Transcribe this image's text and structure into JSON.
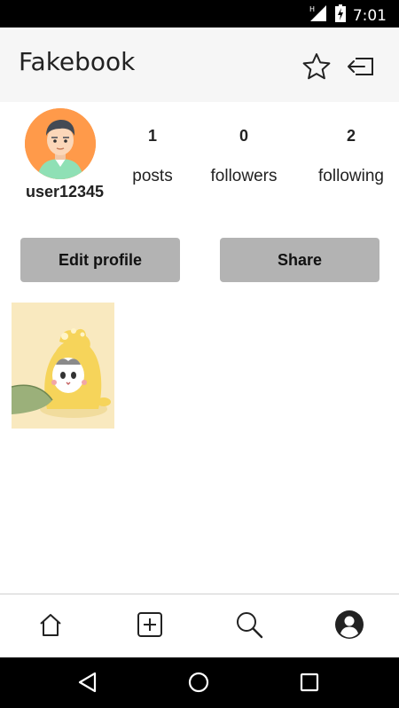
{
  "status_bar": {
    "time": "7:01",
    "network_badge": "H",
    "icons": [
      "signal-icon",
      "battery-charging-icon"
    ]
  },
  "app_bar": {
    "title": "Fakebook",
    "icons": [
      "star-icon",
      "logout-icon"
    ]
  },
  "profile": {
    "username": "user12345",
    "avatar_icon": "man-avatar-icon",
    "stats": [
      {
        "count": "1",
        "label": "posts"
      },
      {
        "count": "0",
        "label": "followers"
      },
      {
        "count": "2",
        "label": "following"
      }
    ]
  },
  "buttons": {
    "edit_profile": "Edit profile",
    "share": "Share"
  },
  "posts": [
    {
      "image": "cat-in-dinosaur-costume"
    }
  ],
  "bottom_nav": {
    "items": [
      "home-icon",
      "add-post-icon",
      "search-icon",
      "profile-icon"
    ],
    "active": "profile-icon"
  },
  "system_nav": {
    "items": [
      "back-icon",
      "home-circle-icon",
      "recents-icon"
    ]
  },
  "colors": {
    "button_bg": "#b3b3b3",
    "avatar_bg": "#ff9a4a",
    "app_bar_bg": "#f6f6f6"
  }
}
